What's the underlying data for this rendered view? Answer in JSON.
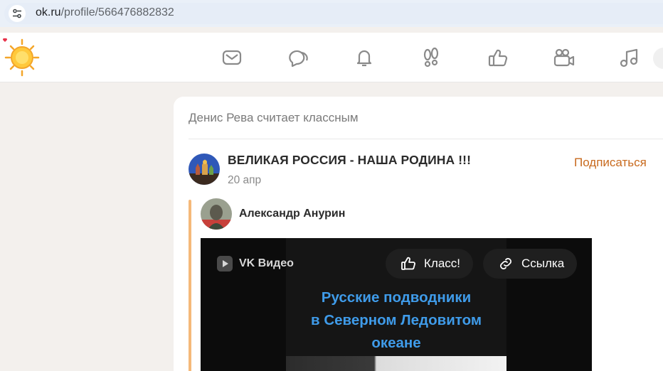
{
  "browser": {
    "url_host": "ok.ru",
    "url_path": "/profile/566476882832"
  },
  "header": {
    "logo_icon": "ok-sun-logo-icon",
    "nav_icons": [
      "mail-icon",
      "chat-bubbles-icon",
      "bell-icon",
      "footprints-icon",
      "thumbs-up-icon",
      "video-camera-icon",
      "music-note-icon"
    ]
  },
  "feed": {
    "activity_text": "Денис Рева считает классным",
    "group_title": "ВЕЛИКАЯ РОССИЯ - НАША РОДИНА !!!",
    "post_date": "20 апр",
    "subscribe_label": "Подписаться",
    "repost_author": "Александр Анурин",
    "video": {
      "brand": "VK Видео",
      "like_label": "Класс!",
      "link_label": "Ссылка",
      "caption_lines": [
        "Русские подводники",
        "в Северном Ледовитом",
        "океане"
      ]
    }
  },
  "colors": {
    "accent_orange": "#c86a1e",
    "repost_bar": "#f5b97a",
    "caption_blue": "#3f9be9"
  }
}
